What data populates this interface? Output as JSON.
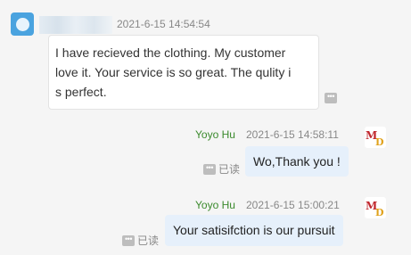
{
  "messages": {
    "incoming": {
      "timestamp": "2021-6-15 14:54:54",
      "lines": [
        "I have recieved the clothing. My customer",
        "love it. Your service is so great. The qulity i",
        "s perfect."
      ]
    },
    "outgoing": [
      {
        "sender": "Yoyo Hu",
        "timestamp": "2021-6-15 14:58:11",
        "text": "Wo,Thank you !",
        "status": "已读"
      },
      {
        "sender": "Yoyo Hu",
        "timestamp": "2021-6-15 15:00:21",
        "text": "Your satisifction is our pursuit",
        "status": "已读"
      }
    ]
  },
  "icons": {
    "incoming_avatar": "avatar-icon",
    "outgoing_avatar": "md-logo-icon",
    "more": "more-options-icon"
  },
  "colors": {
    "sender_name": "#3b8a2d",
    "outgoing_bubble": "#e6f0fb",
    "incoming_bubble": "#ffffff",
    "avatar_blue": "#4aa3df"
  }
}
